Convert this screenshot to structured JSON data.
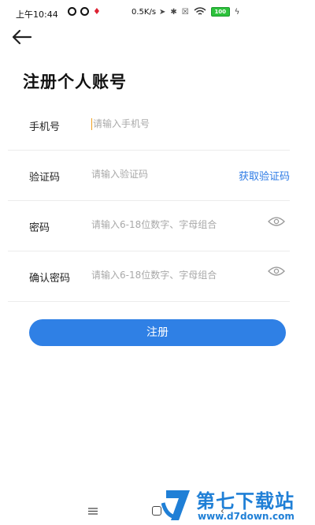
{
  "status_bar": {
    "time": "上午10:44",
    "speed": "0.5K/s",
    "battery": "100"
  },
  "page": {
    "title": "注册个人账号"
  },
  "form": {
    "phone": {
      "label": "手机号",
      "placeholder": "请输入手机号"
    },
    "code": {
      "label": "验证码",
      "placeholder": "请输入验证码",
      "action": "获取验证码"
    },
    "password": {
      "label": "密码",
      "placeholder": "请输入6-18位数字、字母组合"
    },
    "confirm": {
      "label": "确认密码",
      "placeholder": "请输入6-18位数字、字母组合"
    }
  },
  "submit_label": "注册",
  "watermark": {
    "brand": "第七下载站",
    "url": "www.d7down.com"
  },
  "colors": {
    "accent": "#2f80e5",
    "link": "#2d7be5",
    "caret": "#f0a020",
    "watermark": "#1f7fd6"
  },
  "icons": {
    "back": "arrow-left-icon",
    "eye": "eye-icon",
    "nav_menu": "menu-icon",
    "nav_home": "home-icon",
    "nav_back": "back-icon"
  }
}
